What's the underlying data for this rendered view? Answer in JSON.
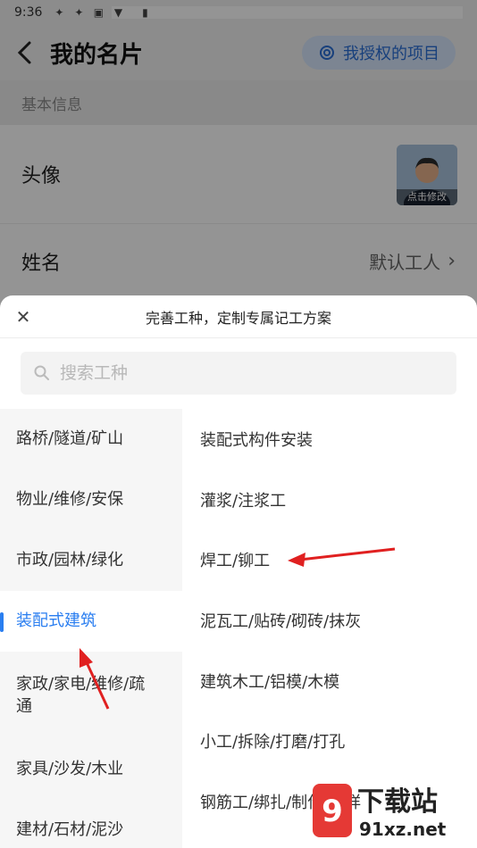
{
  "status_bar": {
    "time": "9:36",
    "icons": [
      "notif-icon-1",
      "notif-icon-2",
      "notif-icon-3"
    ],
    "right_icons": [
      "wifi-icon",
      "battery-icon"
    ]
  },
  "header": {
    "title": "我的名片",
    "auth_button": "我授权的项目",
    "back_icon": "chevron-left-icon"
  },
  "basic_info": {
    "section_title": "基本信息",
    "avatar_label": "头像",
    "avatar_caption": "点击修改",
    "name_label": "姓名",
    "name_value": "默认工人"
  },
  "sheet": {
    "title": "完善工种，定制专属记工方案",
    "search_placeholder": "搜索工种",
    "categories": [
      {
        "label": "路桥/隧道/矿山"
      },
      {
        "label": "物业/维修/安保"
      },
      {
        "label": "市政/园林/绿化"
      },
      {
        "label": "装配式建筑",
        "active": true
      },
      {
        "label": "家政/家电/维修/疏通"
      },
      {
        "label": "家具/沙发/木业"
      },
      {
        "label": "建材/石材/泥沙"
      }
    ],
    "trades": [
      "装配式构件安装",
      "灌浆/注浆工",
      "焊工/铆工",
      "泥瓦工/贴砖/砌砖/抹灰",
      "建筑木工/铝模/木模",
      "小工/拆除/打磨/打孔",
      "钢筋工/绑扎/制作/翻样"
    ]
  },
  "colors": {
    "accent": "#2a7ef0",
    "annotation_arrow": "#e02020"
  },
  "watermark": {
    "text_cn": "下载站",
    "text_url": "91xz.net"
  }
}
